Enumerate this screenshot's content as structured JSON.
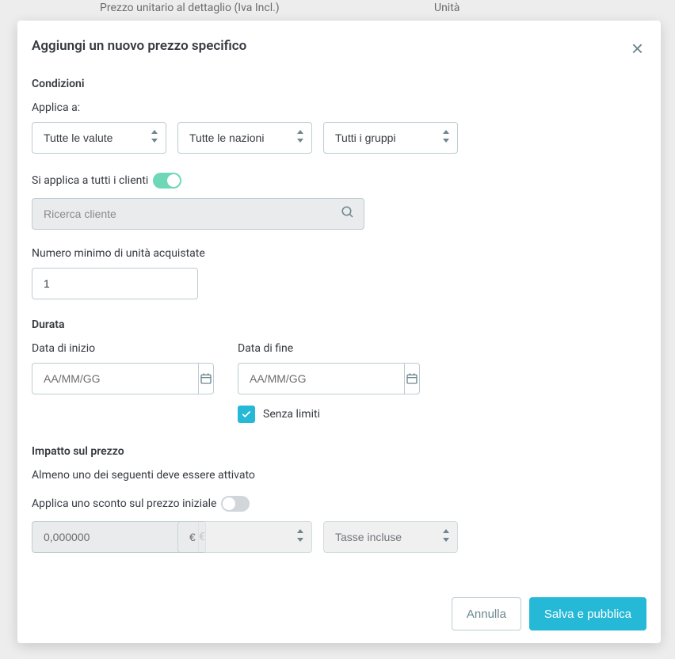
{
  "backdrop": {
    "row1_left": "Prezzo unitario al dettaglio (Iva Incl.)",
    "row1_right": "Unità"
  },
  "modal": {
    "title": "Aggiungi un nuovo prezzo specifico",
    "conditions": {
      "title": "Condizioni",
      "apply_to_label": "Applica a:",
      "currency_select": "Tutte le valute",
      "country_select": "Tutte le nazioni",
      "group_select": "Tutti i gruppi",
      "all_customers_label": "Si applica a tutti i clienti",
      "search_placeholder": "Ricerca cliente",
      "min_qty_label": "Numero minimo di unità acquistate",
      "min_qty_value": "1"
    },
    "duration": {
      "title": "Durata",
      "start_label": "Data di inizio",
      "end_label": "Data di fine",
      "date_placeholder": "AA/MM/GG",
      "unlimited_label": "Senza limiti"
    },
    "impact": {
      "title": "Impatto sul prezzo",
      "subtitle": "Almeno uno dei seguenti deve essere attivato",
      "discount_label": "Applica uno sconto sul prezzo iniziale",
      "discount_value": "0,000000",
      "discount_currency": "€",
      "currency_select": "€",
      "tax_select": "Tasse incluse"
    },
    "footer": {
      "cancel": "Annulla",
      "save": "Salva e pubblica"
    }
  }
}
